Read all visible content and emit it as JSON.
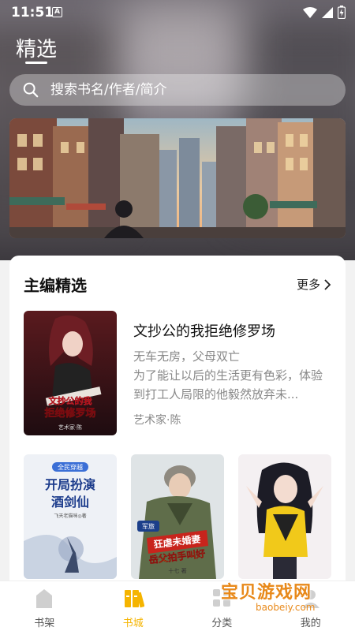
{
  "status": {
    "time": "11:51",
    "notif": "A"
  },
  "header": {
    "title": "精选",
    "search_placeholder": "搜索书名/作者/简介"
  },
  "editor_pick": {
    "title": "主编精选",
    "more": "更多",
    "featured": {
      "title": "文抄公的我拒绝修罗场",
      "description": "无车无房，父母双亡\n为了能让以后的生活更有色彩，体验到打工人局限的他毅然放弃未...",
      "author": "艺术家·陈",
      "cover_text": "文抄公的我拒绝修罗场",
      "cover_author": "艺术家·陈"
    },
    "books": [
      {
        "cover_top": "全民穿越",
        "cover_title": "开局扮演酒剑仙",
        "cover_author": "飞天老猫咪◎著"
      },
      {
        "cover_top": "军旅",
        "cover_title": "狂虐未婚妻岳父拍手叫好",
        "cover_author": "十七 著"
      },
      {
        "cover_title": ""
      }
    ]
  },
  "nav": [
    {
      "label": "书架",
      "icon": "bookshelf-icon"
    },
    {
      "label": "书城",
      "icon": "bookstore-icon"
    },
    {
      "label": "分类",
      "icon": "category-icon"
    },
    {
      "label": "我的",
      "icon": "profile-icon"
    }
  ],
  "watermark": {
    "text": "宝贝游戏网",
    "url": "baobeiy.com"
  },
  "colors": {
    "accent": "#f5b400"
  }
}
